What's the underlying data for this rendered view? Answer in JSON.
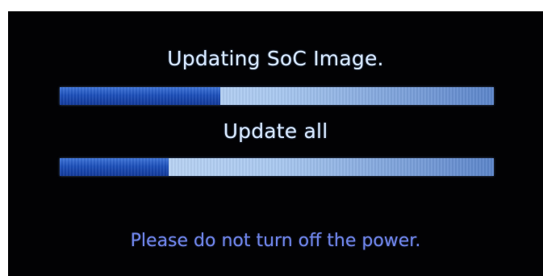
{
  "tasks": [
    {
      "label": "Updating SoC Image.",
      "progress": 0.37
    },
    {
      "label": "Update all",
      "progress": 0.25
    }
  ],
  "warning": "Please do not turn off the power.",
  "colors": {
    "background": "#020204",
    "title_text": "#d7e8ff",
    "bar_fill": "#1c4fb9",
    "bar_track": "#a9c8ef",
    "warning_text": "#6e84e8"
  }
}
